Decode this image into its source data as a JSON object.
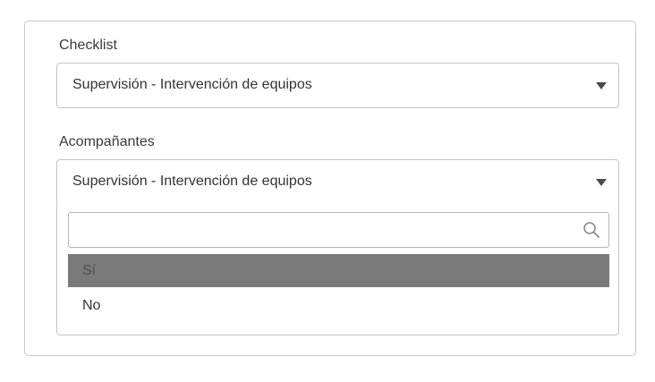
{
  "checklist": {
    "label": "Checklist",
    "selected_value": "Supervisión - Intervención de equipos",
    "caret_icon": "caret-down-icon"
  },
  "acompanantes": {
    "label": "Acompañantes",
    "selected_value": "Supervisión - Intervención de equipos",
    "caret_icon": "caret-down-icon",
    "dropdown": {
      "open": true,
      "search": {
        "value": "",
        "placeholder": "",
        "icon": "search-icon"
      },
      "options": [
        {
          "label": "Sí",
          "highlighted": true
        },
        {
          "label": "No",
          "highlighted": false
        }
      ]
    }
  },
  "colors": {
    "card_border": "#c9c9c9",
    "input_border": "#c4c4c4",
    "highlight_background": "#7a7a7a",
    "text": "#333333"
  }
}
